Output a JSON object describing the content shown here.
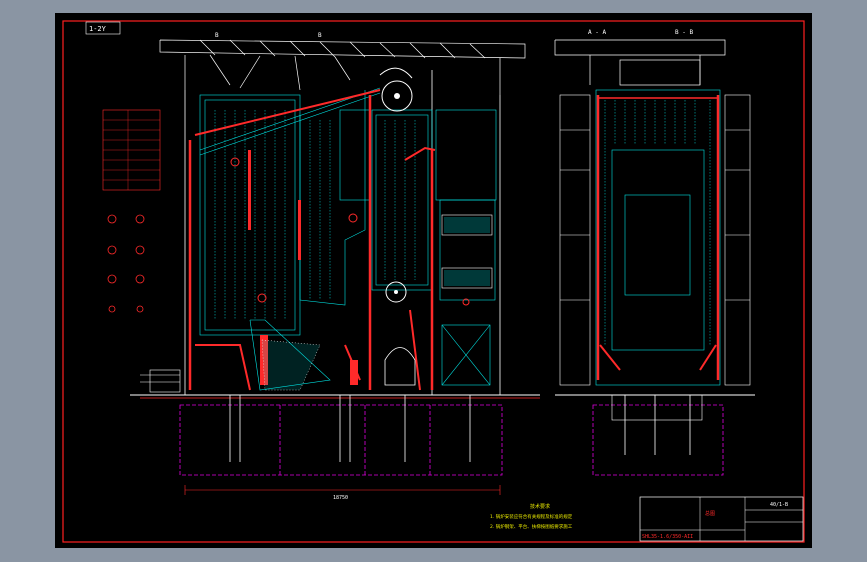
{
  "colors": {
    "background": "#000000",
    "viewport": "#8a95a3",
    "frame": "#ff2020",
    "cyan": "#00e5e5",
    "white": "#ffffff",
    "red": "#ff2a2a",
    "magenta": "#e000e0",
    "yellow": "#e8e800"
  },
  "drawing": {
    "corner_tag": "1-2Y",
    "front_view_labels": [
      "B",
      "B"
    ],
    "side_view_labels": [
      "A - A",
      "B - B"
    ],
    "dimension_total": "18750"
  },
  "notes_block": {
    "heading": "技术要求",
    "lines": [
      "1. 锅炉安装应符合有关规程及标准的规定",
      "2. 锅炉钢架、平台、扶梯按图纸要求施工"
    ]
  },
  "title_block": {
    "drawing_no": "SHL35-1.6/350-AII",
    "sheet": "40/1-B",
    "name": "总图"
  }
}
